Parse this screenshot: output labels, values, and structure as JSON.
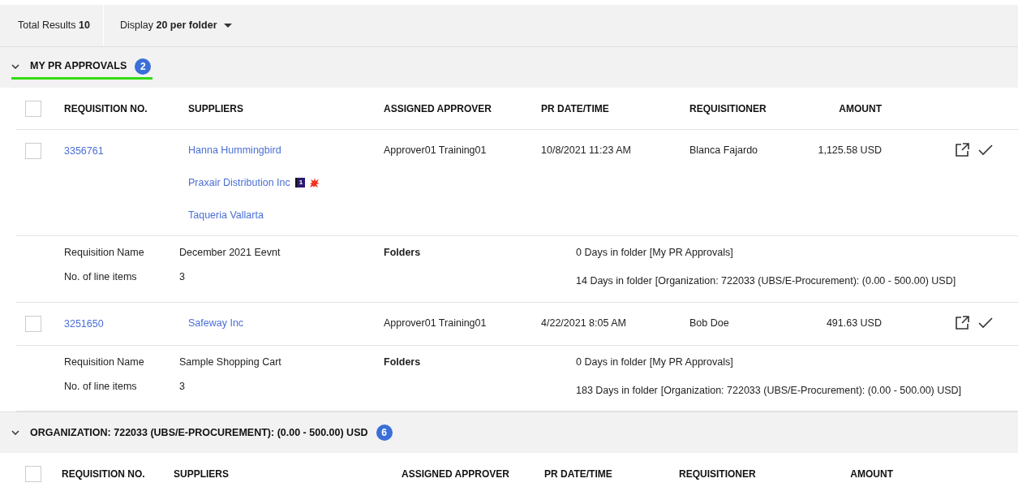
{
  "summary": {
    "total_label": "Total Results",
    "total_value": "10",
    "display_label": "Display",
    "display_value": "20 per folder"
  },
  "groups": [
    {
      "title": "MY PR APPROVALS",
      "count": "2",
      "expanded": true,
      "selected": true,
      "all_checked": false,
      "columns": [
        "REQUISITION NO.",
        "SUPPLIERS",
        "ASSIGNED APPROVER",
        "PR DATE/TIME",
        "REQUISITIONER",
        "AMOUNT"
      ],
      "rows": [
        {
          "checked": false,
          "number": "3356761",
          "suppliers": [
            {
              "name": "Hanna Hummingbird"
            },
            {
              "name": "Praxair Distribution Inc",
              "flag": "1",
              "alert": true
            },
            {
              "name": "Taqueria Vallarta"
            }
          ],
          "approver": "Approver01 Training01",
          "date": "10/8/2021 11:23 AM",
          "requisitioner": "Blanca Fajardo",
          "amount": "1,125.58 USD",
          "details": {
            "name_label": "Requisition Name",
            "name_value": "December 2021 Eevnt",
            "items_label": "No. of line items",
            "items_value": "3",
            "folders_label": "Folders",
            "folders": [
              {
                "days": "0 Days in folder",
                "folder": "[My PR Approvals]"
              },
              {
                "days": "14 Days in folder",
                "folder": "[Organization: 722033 (UBS/E-Procurement): (0.00 - 500.00) USD]"
              }
            ]
          }
        },
        {
          "checked": false,
          "number": "3251650",
          "suppliers": [
            {
              "name": "Safeway Inc"
            }
          ],
          "approver": "Approver01 Training01",
          "date": "4/22/2021 8:05 AM",
          "requisitioner": "Bob Doe",
          "amount": "491.63 USD",
          "details": {
            "name_label": "Requisition Name",
            "name_value": "Sample Shopping Cart",
            "items_label": "No. of line items",
            "items_value": "3",
            "folders_label": "Folders",
            "folders": [
              {
                "days": "0 Days in folder",
                "folder": "[My PR Approvals]"
              },
              {
                "days": "183 Days in folder",
                "folder": "[Organization: 722033 (UBS/E-Procurement): (0.00 - 500.00) USD]"
              }
            ]
          }
        }
      ]
    },
    {
      "title": "ORGANIZATION: 722033 (UBS/E-PROCUREMENT): (0.00 - 500.00) USD",
      "count": "6",
      "expanded": true,
      "selected": false,
      "all_checked": false,
      "columns": [
        "REQUISITION NO.",
        "SUPPLIERS",
        "ASSIGNED APPROVER",
        "PR DATE/TIME",
        "REQUISITIONER",
        "AMOUNT"
      ]
    }
  ]
}
